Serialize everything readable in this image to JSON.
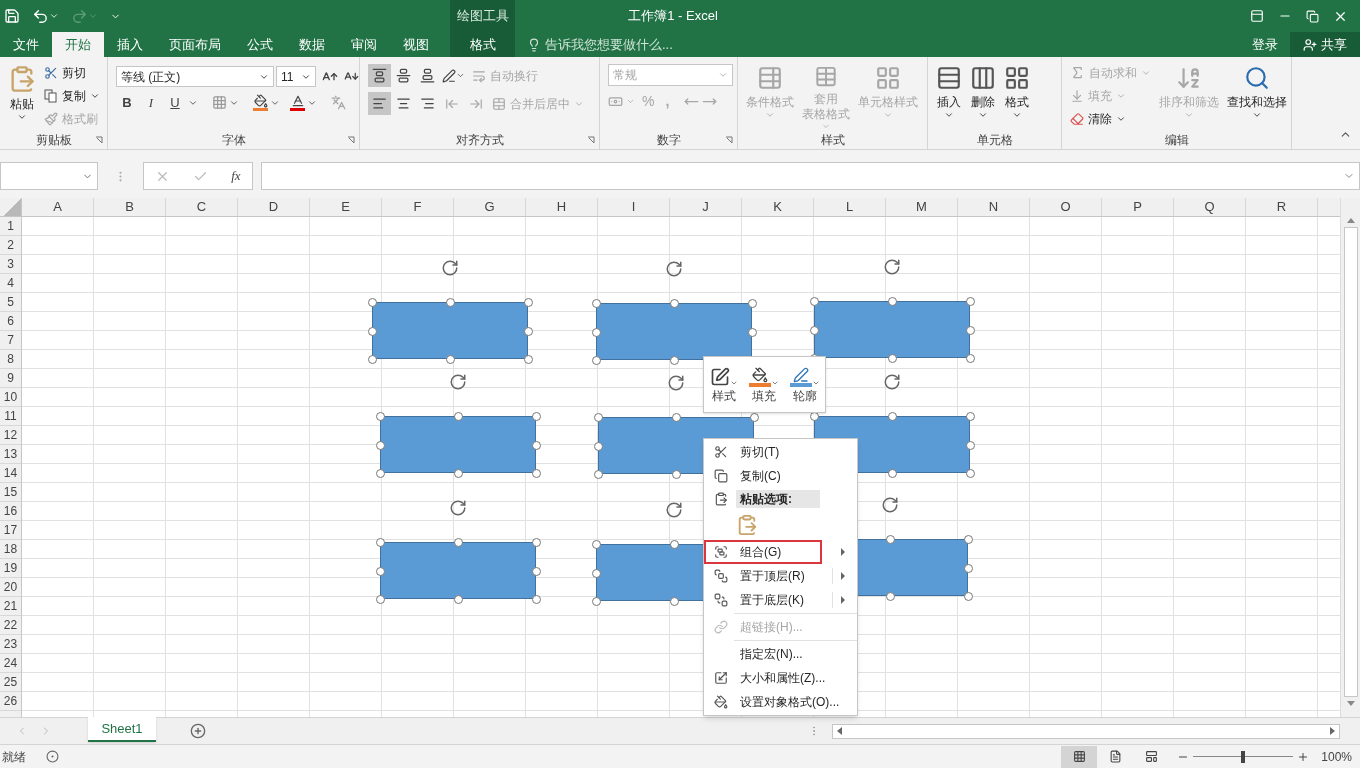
{
  "title_bar": {
    "title": "工作簿1 - Excel",
    "context_label": "绘图工具"
  },
  "tabs": [
    {
      "label": "文件",
      "kind": "normal",
      "selected": false
    },
    {
      "label": "开始",
      "kind": "normal",
      "selected": true
    },
    {
      "label": "插入",
      "kind": "normal",
      "selected": false
    },
    {
      "label": "页面布局",
      "kind": "normal",
      "selected": false
    },
    {
      "label": "公式",
      "kind": "normal",
      "selected": false
    },
    {
      "label": "数据",
      "kind": "normal",
      "selected": false
    },
    {
      "label": "审阅",
      "kind": "normal",
      "selected": false
    },
    {
      "label": "视图",
      "kind": "normal",
      "selected": false
    },
    {
      "label": "格式",
      "kind": "contextual",
      "selected": false
    }
  ],
  "tell_me": {
    "placeholder": "告诉我您想要做什么..."
  },
  "account": {
    "sign_in": "登录",
    "share": "共享"
  },
  "clipboard": {
    "label": "剪贴板",
    "paste": {
      "label": "粘贴",
      "disabled": false
    },
    "cut": {
      "label": "剪切",
      "disabled": false
    },
    "copy": {
      "label": "复制",
      "disabled": false
    },
    "painter": {
      "label": "格式刷",
      "disabled": true
    }
  },
  "font": {
    "label": "字体",
    "name": "等线 (正文)",
    "size": "11",
    "bold": "B",
    "italic": "I",
    "underline": "U"
  },
  "alignment": {
    "label": "对齐方式",
    "vertical": [
      {
        "selected": true
      },
      {
        "selected": false
      },
      {
        "selected": false
      }
    ],
    "horizontal": [
      {
        "selected": true
      },
      {
        "selected": false
      },
      {
        "selected": false
      }
    ],
    "wrap": {
      "label": "自动换行",
      "disabled": true
    },
    "merge": {
      "label": "合并后居中",
      "disabled": true
    }
  },
  "number": {
    "label": "数字",
    "format": {
      "label": "常规",
      "disabled": true
    },
    "percent": "%",
    "comma": ","
  },
  "styles": {
    "label": "样式",
    "items": [
      {
        "label": "条件格式",
        "disabled": true
      },
      {
        "label": "套用",
        "label_2": "表格格式",
        "disabled": true
      },
      {
        "label": "单元格样式",
        "disabled": true
      }
    ]
  },
  "cells": {
    "label": "单元格",
    "items": [
      {
        "label": "插入",
        "disabled": false
      },
      {
        "label": "删除",
        "disabled": false
      },
      {
        "label": "格式",
        "disabled": false
      }
    ]
  },
  "editing": {
    "label": "编辑",
    "autosum": {
      "label": "自动求和",
      "disabled": true
    },
    "fill": {
      "label": "填充",
      "disabled": true
    },
    "clear": {
      "label": "清除",
      "disabled": false
    },
    "sort": {
      "label": "排序和筛选",
      "disabled": true
    },
    "find": {
      "label": "查找和选择",
      "disabled": false
    }
  },
  "formula_bar": {
    "function_label": "fx"
  },
  "columns": [
    "A",
    "B",
    "C",
    "D",
    "E",
    "F",
    "G",
    "H",
    "I",
    "J",
    "K",
    "L",
    "M",
    "N",
    "O",
    "P",
    "Q",
    "R"
  ],
  "rows": [
    "1",
    "2",
    "3",
    "4",
    "5",
    "6",
    "7",
    "8",
    "9",
    "10",
    "11",
    "12",
    "13",
    "14",
    "15",
    "16",
    "17",
    "18",
    "19",
    "20",
    "21",
    "22",
    "23",
    "24",
    "25",
    "26"
  ],
  "shapes": [
    {
      "selected": true
    },
    {
      "selected": true
    },
    {
      "selected": true
    },
    {
      "selected": true
    },
    {
      "selected": true
    },
    {
      "selected": true
    },
    {
      "selected": true
    },
    {
      "selected": true
    },
    {
      "selected": true
    }
  ],
  "mini_toolbar": [
    "样式",
    "填充",
    "轮廓"
  ],
  "context_menu": [
    {
      "kind": "command",
      "label": "剪切(T)",
      "disabled": false,
      "submenu": false,
      "split": false,
      "highlighted": false,
      "divider_above": false
    },
    {
      "kind": "command",
      "label": "复制(C)",
      "disabled": false,
      "submenu": false,
      "split": false,
      "highlighted": false,
      "divider_above": false
    },
    {
      "kind": "header",
      "label": "粘贴选项:",
      "disabled": false,
      "submenu": false,
      "split": false,
      "highlighted": false,
      "divider_above": false
    },
    {
      "kind": "paste_options",
      "disabled": false,
      "submenu": false,
      "split": false,
      "highlighted": false,
      "divider_above": false
    },
    {
      "kind": "command",
      "label": "组合(G)",
      "disabled": false,
      "submenu": true,
      "split": false,
      "highlighted": true,
      "divider_above": false
    },
    {
      "kind": "command",
      "label": "置于顶层(R)",
      "disabled": false,
      "submenu": true,
      "split": true,
      "highlighted": false,
      "divider_above": false
    },
    {
      "kind": "command",
      "label": "置于底层(K)",
      "disabled": false,
      "submenu": true,
      "split": true,
      "highlighted": false,
      "divider_above": false
    },
    {
      "kind": "command",
      "label": "超链接(H)...",
      "disabled": true,
      "submenu": false,
      "split": false,
      "highlighted": false,
      "divider_above": true
    },
    {
      "kind": "command",
      "label": "指定宏(N)...",
      "disabled": false,
      "submenu": false,
      "split": false,
      "highlighted": false,
      "divider_above": true
    },
    {
      "kind": "command",
      "label": "大小和属性(Z)...",
      "disabled": false,
      "submenu": false,
      "split": false,
      "highlighted": false,
      "divider_above": false
    },
    {
      "kind": "command",
      "label": "设置对象格式(O)...",
      "disabled": false,
      "submenu": false,
      "split": false,
      "highlighted": false,
      "divider_above": false
    }
  ],
  "sheets": [
    {
      "label": "Sheet1",
      "selected": true
    }
  ],
  "status_bar": {
    "status": "就绪",
    "views": [
      {
        "selected": true
      },
      {
        "selected": false
      },
      {
        "selected": false
      }
    ],
    "level": 0.5,
    "zoom": "100%"
  }
}
